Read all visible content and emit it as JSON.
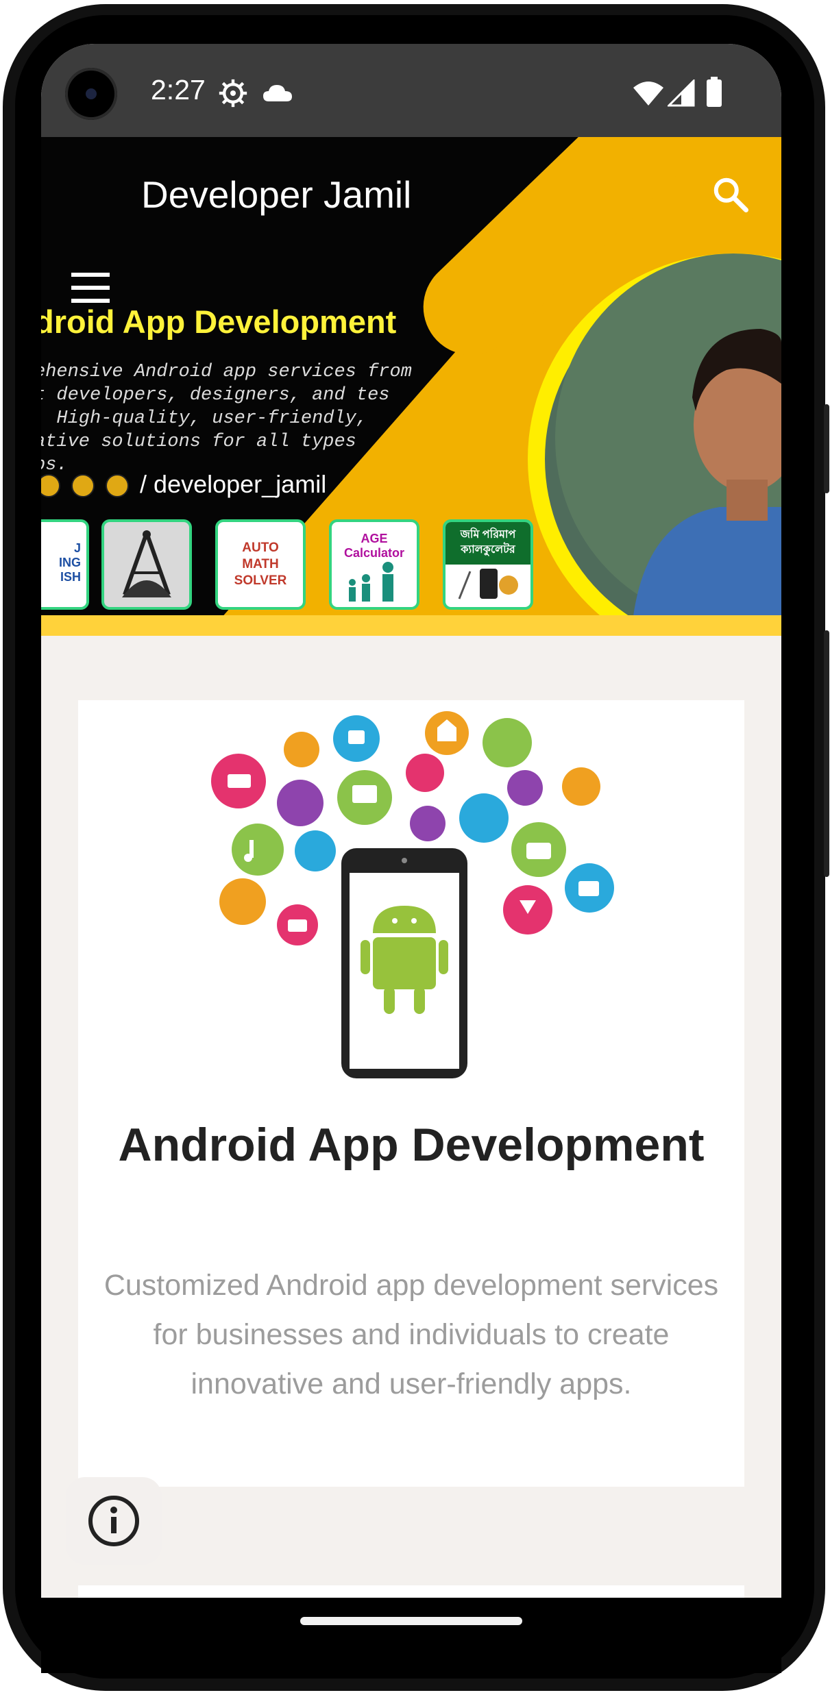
{
  "status_bar": {
    "time": "2:27",
    "icons": [
      "settings-gear-icon",
      "cloud-icon",
      "wifi-icon",
      "signal-icon",
      "battery-icon"
    ]
  },
  "app_bar": {
    "title": "Developer Jamil",
    "menu_icon": "hamburger-menu-icon",
    "search_icon": "search-icon"
  },
  "banner": {
    "headline": "droid App Development",
    "description": "ehensive Android app services from\nt developers, designers, and tes\n. High-quality, user-friendly,\native solutions for all types\nps.",
    "social_handle": "/ developer_jamil",
    "tiles": [
      {
        "label": "J\nING\nISH"
      },
      {
        "label": "compass-tool"
      },
      {
        "label": "AUTO\nMATH\nSOLVER"
      },
      {
        "label": "AGE\nCalculator"
      },
      {
        "label": "জমি পরিমাপ\nক্যালকুলেটর"
      }
    ],
    "colors": {
      "accent_yellow": "#f2b100",
      "headline_yellow": "#fff23a",
      "tile_border": "#33d480"
    }
  },
  "card": {
    "title": "Android App Development",
    "description": "Customized Android app development services for businesses and individuals to create innovative and user-friendly apps."
  },
  "info_button": {
    "icon": "info-icon"
  }
}
